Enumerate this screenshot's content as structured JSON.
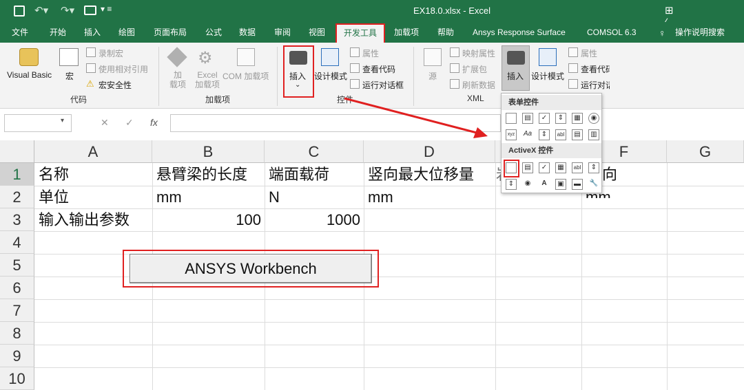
{
  "title": {
    "text": "EX18.0.xlsx  -  Excel"
  },
  "tabs": [
    "文件",
    "开始",
    "插入",
    "绘图",
    "页面布局",
    "公式",
    "数据",
    "审阅",
    "视图",
    "开发工具",
    "加载项",
    "帮助",
    "Ansys Response Surface",
    "COMSOL 6.3",
    "操作说明搜索"
  ],
  "ribbon": {
    "code": {
      "visual_basic": "Visual Basic",
      "macros": "宏",
      "record": "录制宏",
      "relative": "使用相对引用",
      "security": "宏安全性",
      "group": "代码"
    },
    "addins": {
      "addins": "加\n载项",
      "excel_addins": "Excel\n加载项",
      "com_addins": "COM 加载项",
      "group": "加载项"
    },
    "controls": {
      "insert": "插入",
      "design": "设计模式",
      "properties": "属性",
      "view_code": "查看代码",
      "run_dialog": "运行对话框",
      "group": "控件"
    },
    "xml": {
      "source": "源",
      "map_props": "映射属性",
      "expansion": "扩展包",
      "refresh": "刷新数据",
      "group": "XML"
    },
    "controls2": {
      "insert": "插入",
      "design": "设计模式",
      "properties": "属性",
      "view_code": "查看代码",
      "run_dialog": "运行对话"
    }
  },
  "dropdown": {
    "form_controls": "表单控件",
    "activex_controls": "ActiveX 控件"
  },
  "sheet": {
    "columns": [
      "A",
      "B",
      "C",
      "D",
      "E",
      "F",
      "G"
    ],
    "rows": [
      "1",
      "2",
      "3",
      "4",
      "5",
      "6",
      "7",
      "8",
      "9",
      "10"
    ],
    "cells": {
      "A1": "名称",
      "B1": "悬臂梁的长度",
      "C1": "端面载荷",
      "D1": "竖向最大位移量",
      "E1": "岩",
      "F1": "向",
      "A2": "单位",
      "B2": "mm",
      "C2": "N",
      "D2": "mm",
      "F2": "mm",
      "A3": "输入输出参数",
      "B3": "100",
      "C3": "1000"
    },
    "button_label": "ANSYS Workbench"
  },
  "colors": {
    "accent": "#217346",
    "highlight": "#e02020"
  }
}
